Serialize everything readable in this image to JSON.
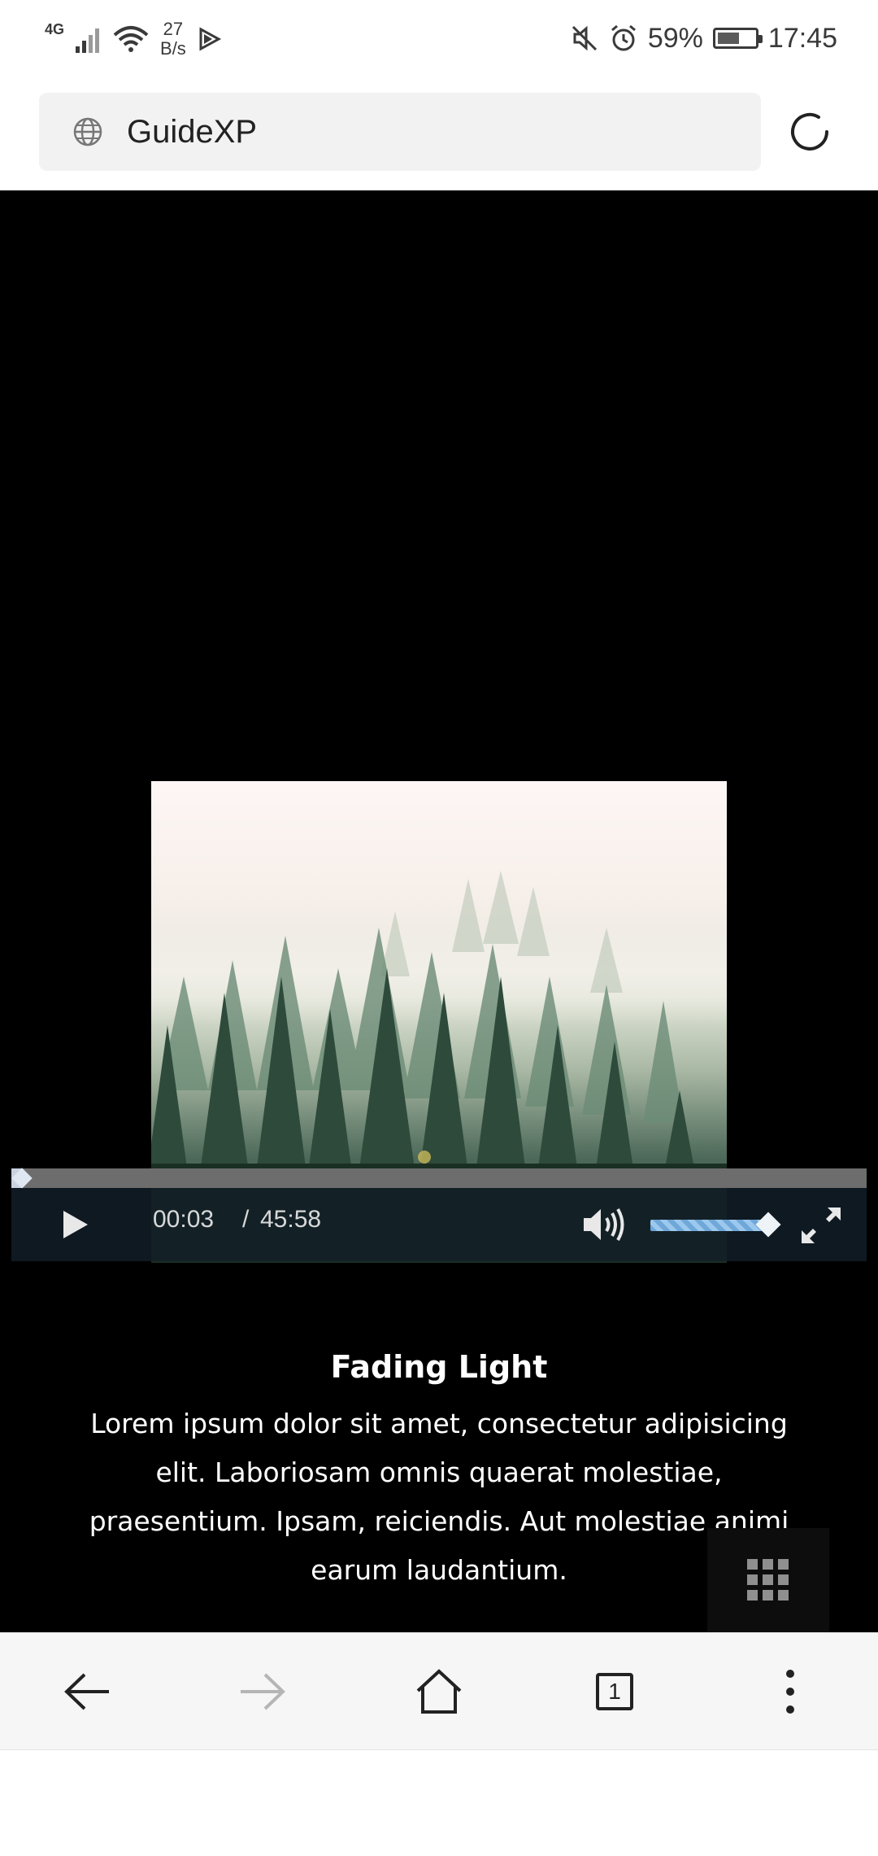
{
  "status_bar": {
    "network": "4G",
    "speed_value": "27",
    "speed_unit": "B/s",
    "battery": "59%",
    "battery_level": 0.59,
    "time": "17:45"
  },
  "browser": {
    "url": "GuideXP"
  },
  "video": {
    "current_time": "00:03",
    "separator": "/",
    "duration": "45:58",
    "progress": 0.001,
    "volume": 0.95
  },
  "caption": {
    "title": "Fading Light",
    "text": "Lorem ipsum dolor sit amet, consectetur adipisicing elit. Laboriosam omnis quaerat molestiae, praesentium. Ipsam, reiciendis. Aut molestiae animi earum laudantium."
  },
  "nav": {
    "tab_count": "1"
  },
  "colors": {
    "page_background": "#000000",
    "control_bar": "#121e28",
    "volume_accent": "#6fa7d8"
  }
}
